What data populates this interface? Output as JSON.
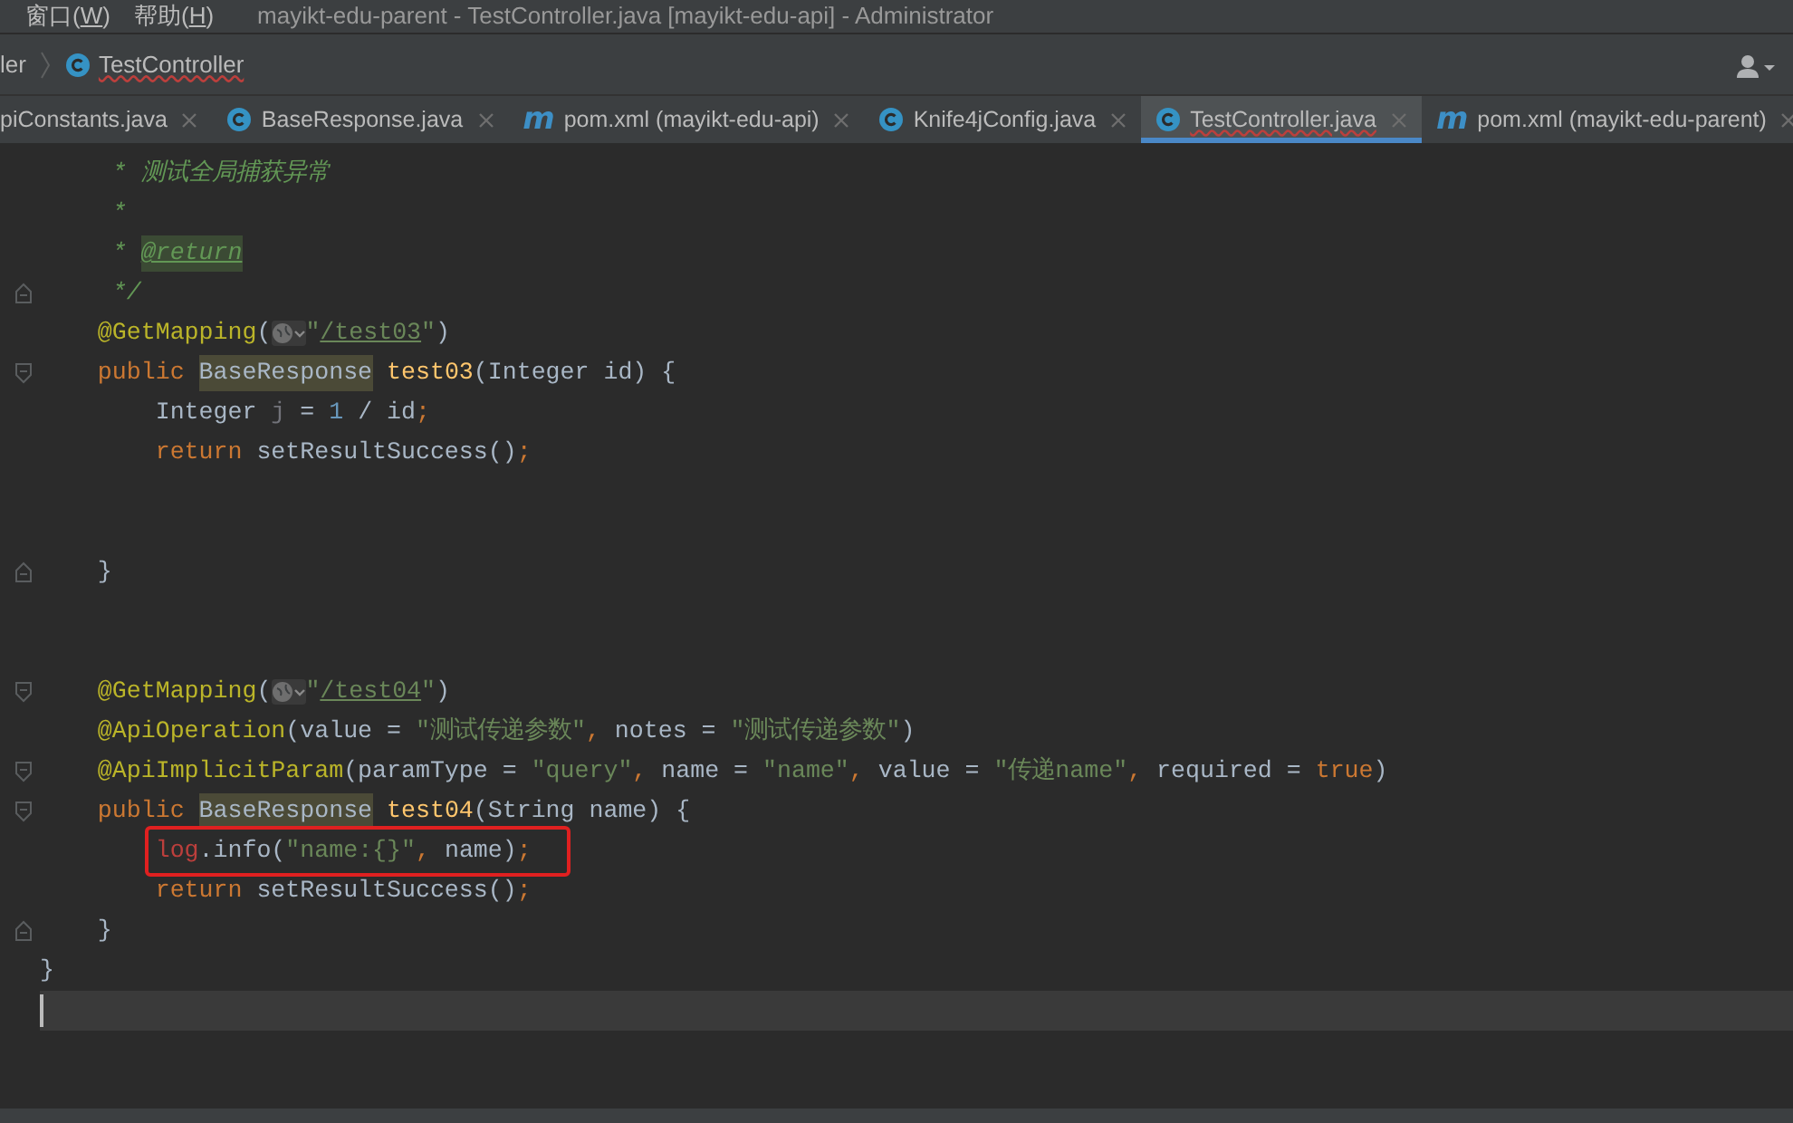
{
  "menu": [
    {
      "label": "窗口(W)"
    },
    {
      "label": "帮助(H)"
    }
  ],
  "window": {
    "title": "mayikt-edu-parent - TestController.java [mayikt-edu-api] - Administrator"
  },
  "breadcrumbs": [
    {
      "label": "ler",
      "kind": "plain",
      "error": false
    },
    {
      "label": "TestController",
      "kind": "class",
      "error": true
    }
  ],
  "tabs": [
    {
      "label": "piConstants.java",
      "kind": "plain",
      "selected": false,
      "error": false
    },
    {
      "label": "BaseResponse.java",
      "kind": "class",
      "selected": false,
      "error": false
    },
    {
      "label": "pom.xml (mayikt-edu-api)",
      "kind": "maven",
      "icon_glyph": "m",
      "selected": false,
      "error": false
    },
    {
      "label": "Knife4jConfig.java",
      "kind": "class",
      "selected": false,
      "error": false
    },
    {
      "label": "TestController.java",
      "kind": "class",
      "selected": true,
      "error": true
    },
    {
      "label": "pom.xml (mayikt-edu-parent)",
      "kind": "maven",
      "icon_glyph": "m",
      "selected": false,
      "error": false
    }
  ],
  "editor": {
    "lines": [
      {
        "kind": "code",
        "fold_start": false,
        "fold_end": false,
        "boxed": false,
        "tokens": [
          {
            "kind": "comment",
            "text": "     * 测试全局捕获异常"
          }
        ]
      },
      {
        "kind": "code",
        "fold_start": false,
        "fold_end": false,
        "boxed": false,
        "tokens": [
          {
            "kind": "comment",
            "text": "     *"
          }
        ]
      },
      {
        "kind": "code",
        "fold_start": false,
        "fold_end": false,
        "boxed": false,
        "tokens": [
          {
            "kind": "comment",
            "text": "     * "
          },
          {
            "kind": "doc-tag",
            "text": "@return"
          }
        ]
      },
      {
        "kind": "code",
        "fold_start": false,
        "fold_end": true,
        "boxed": false,
        "tokens": [
          {
            "kind": "comment",
            "text": "     */"
          }
        ]
      },
      {
        "kind": "code",
        "fold_start": false,
        "fold_end": false,
        "boxed": false,
        "tokens": [
          {
            "kind": "annotation",
            "text": "    @GetMapping"
          },
          {
            "kind": "plain",
            "text": "("
          },
          {
            "kind": "globe"
          },
          {
            "kind": "string",
            "text": "\""
          },
          {
            "kind": "link",
            "text": "/test03"
          },
          {
            "kind": "string",
            "text": "\""
          },
          {
            "kind": "plain",
            "text": ")"
          }
        ]
      },
      {
        "kind": "code",
        "fold_start": true,
        "fold_end": false,
        "boxed": false,
        "tokens": [
          {
            "kind": "keyword",
            "text": "    public "
          },
          {
            "kind": "type-hit",
            "text": "BaseResponse"
          },
          {
            "kind": "method",
            "text": " test03"
          },
          {
            "kind": "plain",
            "text": "(Integer id) {"
          }
        ]
      },
      {
        "kind": "code",
        "fold_start": false,
        "fold_end": false,
        "boxed": false,
        "tokens": [
          {
            "kind": "plain",
            "text": "        Integer "
          },
          {
            "kind": "unused",
            "text": "j"
          },
          {
            "kind": "plain",
            "text": " = "
          },
          {
            "kind": "number",
            "text": "1"
          },
          {
            "kind": "plain",
            "text": " / id"
          },
          {
            "kind": "keyword",
            "text": ";"
          }
        ]
      },
      {
        "kind": "code",
        "fold_start": false,
        "fold_end": false,
        "boxed": false,
        "tokens": [
          {
            "kind": "keyword",
            "text": "        return"
          },
          {
            "kind": "plain",
            "text": " setResultSuccess()"
          },
          {
            "kind": "keyword",
            "text": ";"
          }
        ]
      },
      {
        "kind": "code",
        "fold_start": false,
        "fold_end": false,
        "boxed": false
      },
      {
        "kind": "code",
        "fold_start": false,
        "fold_end": false,
        "boxed": false
      },
      {
        "kind": "code",
        "fold_start": false,
        "fold_end": true,
        "boxed": false,
        "tokens": [
          {
            "kind": "plain",
            "text": "    }"
          }
        ]
      },
      {
        "kind": "code",
        "fold_start": false,
        "fold_end": false,
        "boxed": false
      },
      {
        "kind": "code",
        "fold_start": false,
        "fold_end": false,
        "boxed": false
      },
      {
        "kind": "code",
        "fold_start": true,
        "fold_end": false,
        "boxed": false,
        "tokens": [
          {
            "kind": "annotation",
            "text": "    @GetMapping"
          },
          {
            "kind": "plain",
            "text": "("
          },
          {
            "kind": "globe"
          },
          {
            "kind": "string",
            "text": "\""
          },
          {
            "kind": "link",
            "text": "/test04"
          },
          {
            "kind": "string",
            "text": "\""
          },
          {
            "kind": "plain",
            "text": ")"
          }
        ]
      },
      {
        "kind": "code",
        "fold_start": false,
        "fold_end": false,
        "boxed": false,
        "tokens": [
          {
            "kind": "annotation",
            "text": "    @ApiOperation"
          },
          {
            "kind": "plain",
            "text": "(value = "
          },
          {
            "kind": "string",
            "text": "\"测试传递参数\""
          },
          {
            "kind": "keyword",
            "text": ","
          },
          {
            "kind": "plain",
            "text": " notes = "
          },
          {
            "kind": "string",
            "text": "\"测试传递参数\""
          },
          {
            "kind": "plain",
            "text": ")"
          }
        ]
      },
      {
        "kind": "code",
        "fold_start": true,
        "fold_end": false,
        "boxed": false,
        "tokens": [
          {
            "kind": "annotation",
            "text": "    @ApiImplicitParam"
          },
          {
            "kind": "plain",
            "text": "(paramType = "
          },
          {
            "kind": "string",
            "text": "\"query\""
          },
          {
            "kind": "keyword",
            "text": ","
          },
          {
            "kind": "plain",
            "text": " name = "
          },
          {
            "kind": "string",
            "text": "\"name\""
          },
          {
            "kind": "keyword",
            "text": ","
          },
          {
            "kind": "plain",
            "text": " value = "
          },
          {
            "kind": "string",
            "text": "\"传递name\""
          },
          {
            "kind": "keyword",
            "text": ","
          },
          {
            "kind": "plain",
            "text": " required = "
          },
          {
            "kind": "keyword",
            "text": "true"
          },
          {
            "kind": "plain",
            "text": ")"
          }
        ]
      },
      {
        "kind": "code",
        "fold_start": true,
        "fold_end": false,
        "boxed": false,
        "tokens": [
          {
            "kind": "keyword",
            "text": "    public "
          },
          {
            "kind": "type-hit",
            "text": "BaseResponse"
          },
          {
            "kind": "method",
            "text": " test04"
          },
          {
            "kind": "plain",
            "text": "(String name) {"
          }
        ]
      },
      {
        "kind": "code",
        "fold_start": false,
        "fold_end": false,
        "boxed": true,
        "tokens": [
          {
            "kind": "error-field",
            "text": "        log"
          },
          {
            "kind": "plain",
            "text": ".info("
          },
          {
            "kind": "string",
            "text": "\"name:{}\""
          },
          {
            "kind": "keyword",
            "text": ","
          },
          {
            "kind": "plain",
            "text": " name)"
          },
          {
            "kind": "keyword",
            "text": ";"
          }
        ]
      },
      {
        "kind": "code",
        "fold_start": false,
        "fold_end": false,
        "boxed": false,
        "tokens": [
          {
            "kind": "keyword",
            "text": "        return"
          },
          {
            "kind": "plain",
            "text": " setResultSuccess()"
          },
          {
            "kind": "keyword",
            "text": ";"
          }
        ]
      },
      {
        "kind": "code",
        "fold_start": false,
        "fold_end": true,
        "boxed": false,
        "tokens": [
          {
            "kind": "plain",
            "text": "    }"
          }
        ]
      },
      {
        "kind": "code",
        "fold_start": false,
        "fold_end": false,
        "boxed": false,
        "tokens": [
          {
            "kind": "plain",
            "text": "}"
          }
        ]
      },
      {
        "kind": "caret",
        "fold_start": false,
        "fold_end": false,
        "boxed": false
      }
    ]
  }
}
